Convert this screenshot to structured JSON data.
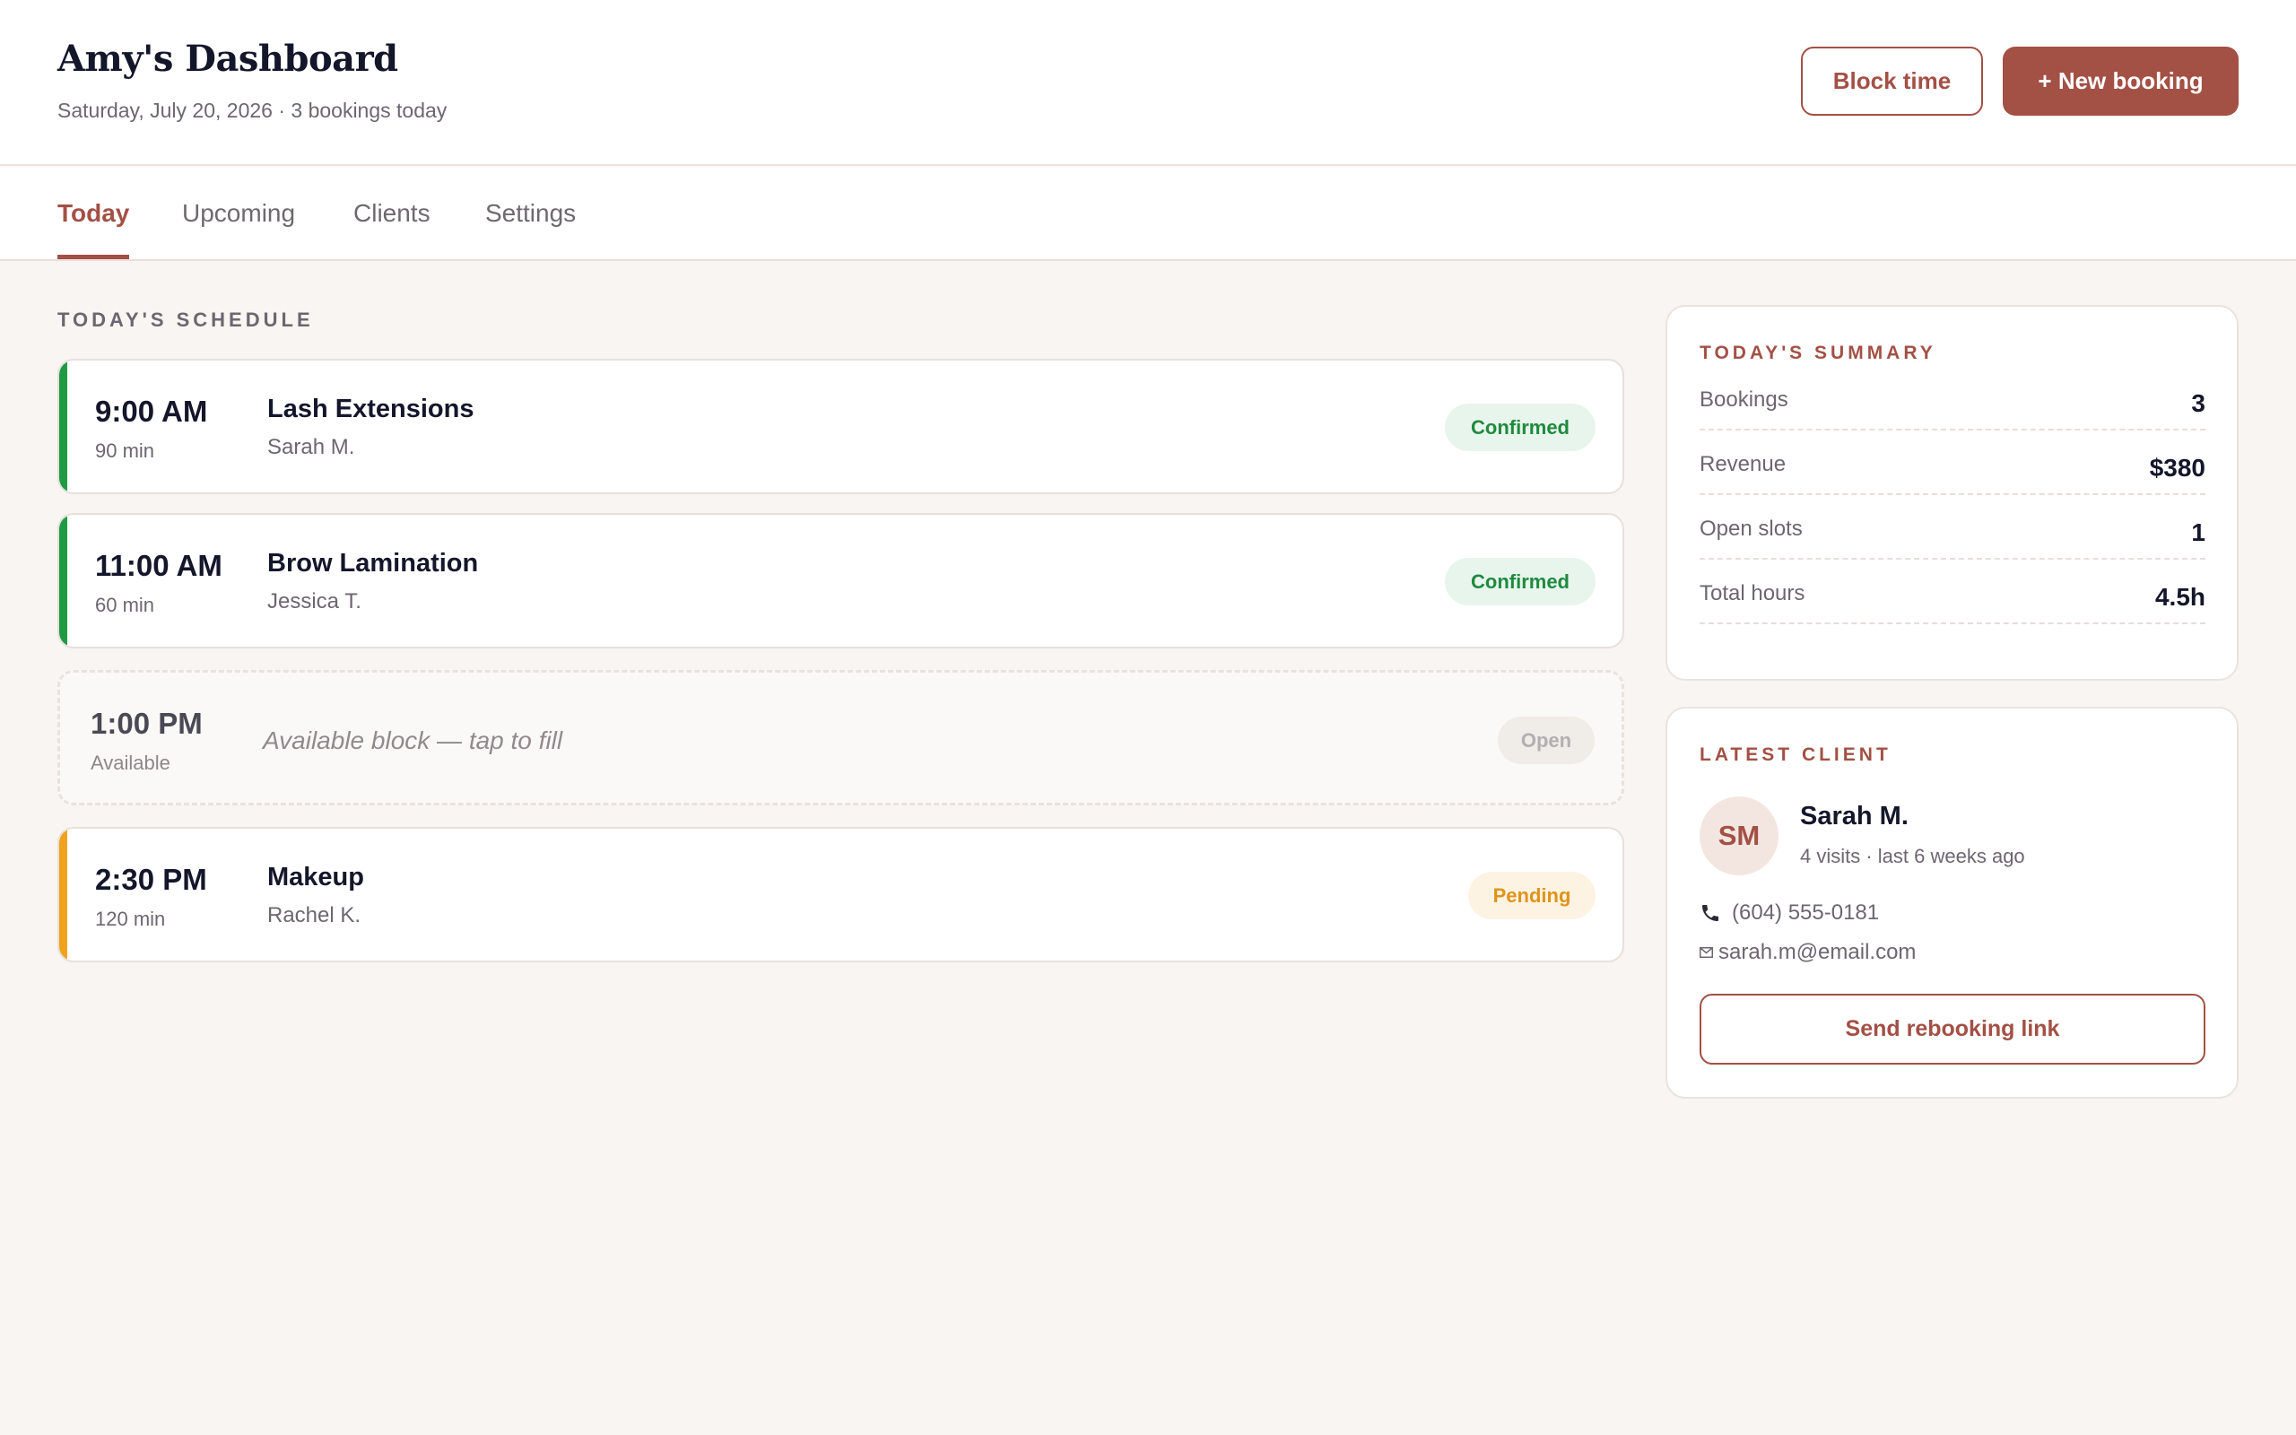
{
  "header": {
    "title": "Amy's Dashboard",
    "subtitle": "Saturday, July 20, 2026 · 3 bookings today",
    "block_time_label": "Block time",
    "new_booking_label": "+ New booking"
  },
  "tabs": [
    {
      "label": "Today",
      "active": true
    },
    {
      "label": "Upcoming",
      "active": false
    },
    {
      "label": "Clients",
      "active": false
    },
    {
      "label": "Settings",
      "active": false
    }
  ],
  "schedule": {
    "heading": "TODAY'S SCHEDULE",
    "appointments": [
      {
        "time": "9:00 AM",
        "duration": "90 min",
        "service": "Lash Extensions",
        "client": "Sarah M.",
        "status": "Confirmed",
        "accent": "#1f9a45"
      },
      {
        "time": "11:00 AM",
        "duration": "60 min",
        "service": "Brow Lamination",
        "client": "Jessica T.",
        "status": "Confirmed",
        "accent": "#1f9a45"
      },
      {
        "time": "1:00 PM",
        "duration": "Available",
        "note": "Available block — tap to fill",
        "status": "Open"
      },
      {
        "time": "2:30 PM",
        "duration": "120 min",
        "service": "Makeup",
        "client": "Rachel K.",
        "status": "Pending",
        "accent": "#f0a21c"
      }
    ]
  },
  "summary": {
    "heading": "TODAY'S SUMMARY",
    "rows": [
      {
        "label": "Bookings",
        "value": "3"
      },
      {
        "label": "Revenue",
        "value": "$380"
      },
      {
        "label": "Open slots",
        "value": "1"
      },
      {
        "label": "Total hours",
        "value": "4.5h"
      }
    ]
  },
  "latest_client": {
    "heading": "LATEST CLIENT",
    "initials": "SM",
    "name": "Sarah M.",
    "meta": "4 visits · last 6 weeks ago",
    "phone": "(604) 555-0181",
    "email": "sarah.m@email.com",
    "button_label": "Send rebooking link",
    "phone_icon": "phone-icon",
    "email_icon": "mail-icon"
  },
  "colors": {
    "brand": "#a35045",
    "confirmed": "#1f8a3f",
    "pending": "#e0931a",
    "background": "#f8f5f2"
  }
}
